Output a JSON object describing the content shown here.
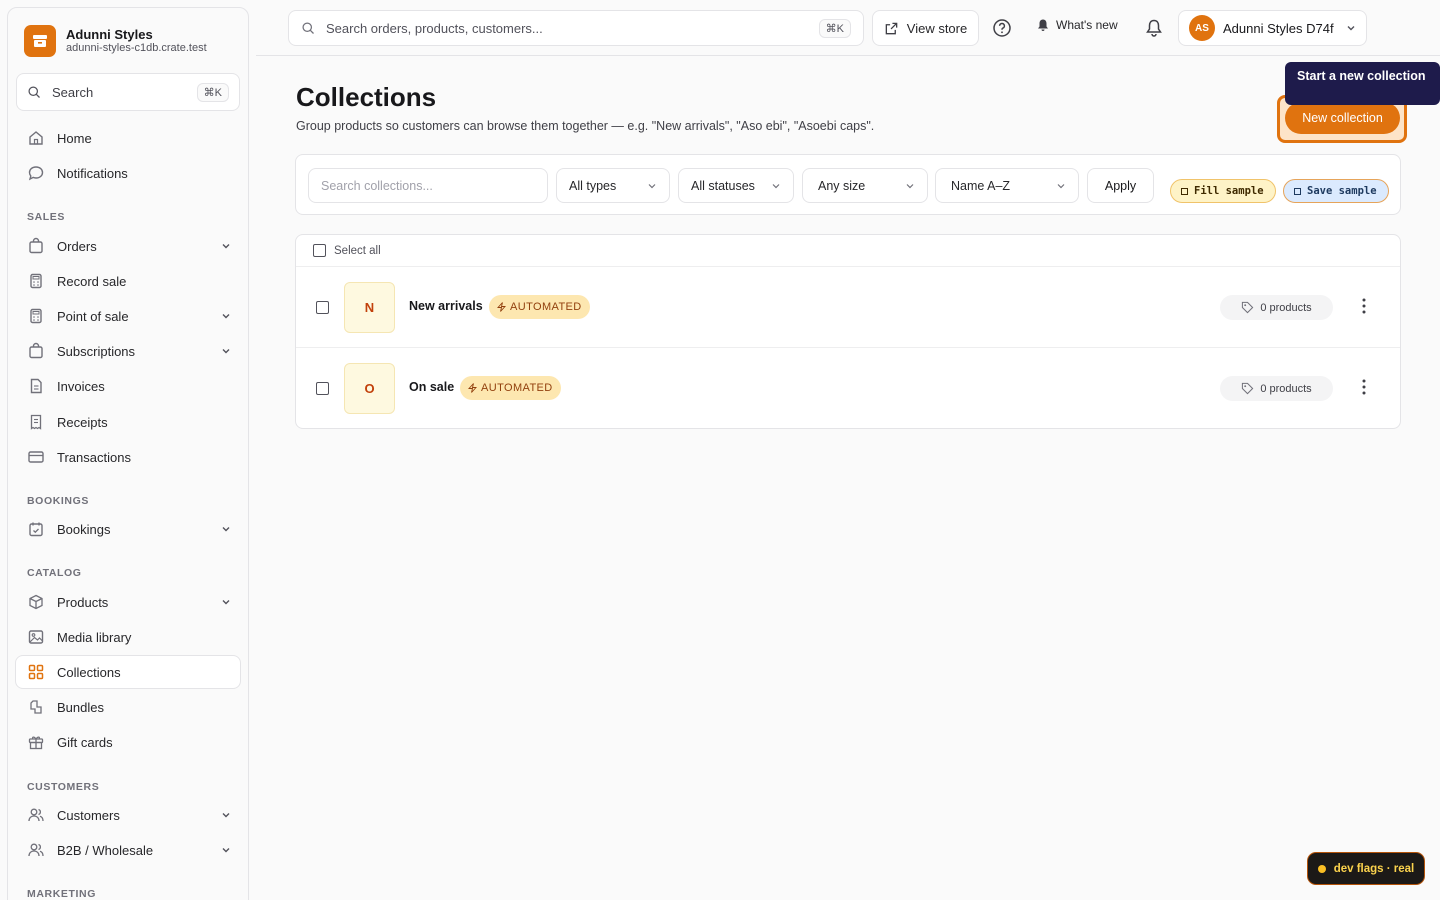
{
  "brand": {
    "name": "Adunni Styles",
    "domain": "adunni-styles-c1db.crate.test"
  },
  "sidebar": {
    "search_label": "Search",
    "search_kbd": "⌘K",
    "items": [
      {
        "label": "Home"
      },
      {
        "label": "Notifications"
      },
      {
        "label": "Orders"
      },
      {
        "label": "Record sale"
      },
      {
        "label": "Point of sale"
      },
      {
        "label": "Subscriptions"
      },
      {
        "label": "Invoices"
      },
      {
        "label": "Receipts"
      },
      {
        "label": "Transactions"
      },
      {
        "label": "Bookings"
      },
      {
        "label": "Products"
      },
      {
        "label": "Media library"
      },
      {
        "label": "Collections"
      },
      {
        "label": "Bundles"
      },
      {
        "label": "Gift cards"
      },
      {
        "label": "Customers"
      },
      {
        "label": "B2B / Wholesale"
      }
    ],
    "sections": {
      "sales": "SALES",
      "bookings": "BOOKINGS",
      "catalog": "CATALOG",
      "customers": "CUSTOMERS",
      "marketing": "MARKETING"
    }
  },
  "topbar": {
    "search_placeholder": "Search orders, products, customers...",
    "search_kbd": "⌘K",
    "view_store": "View store",
    "whats_new": "What's new",
    "account_initials": "AS",
    "account_name": "Adunni Styles D74f"
  },
  "page": {
    "title": "Collections",
    "subtitle": "Group products so customers can browse them together — e.g. \"New arrivals\", \"Aso ebi\", \"Asoebi caps\".",
    "tooltip": "Start a new collection",
    "new_button": "New collection"
  },
  "filters": {
    "search_placeholder": "Search collections...",
    "type": "All types",
    "status": "All statuses",
    "size": "Any size",
    "sort": "Name A–Z",
    "apply": "Apply",
    "fill_sample": "Fill sample",
    "save_sample": "Save sample"
  },
  "table": {
    "select_all": "Select all",
    "rows": [
      {
        "initial": "N",
        "name": "New arrivals",
        "badge": "AUTOMATED",
        "count": "0 products"
      },
      {
        "initial": "O",
        "name": "On sale",
        "badge": "AUTOMATED",
        "count": "0 products"
      }
    ]
  },
  "devflags": "dev flags · real",
  "colors": {
    "accent": "#e0730f",
    "tooltip_bg": "#1e1b4b",
    "badge_bg": "#fde7b0"
  }
}
